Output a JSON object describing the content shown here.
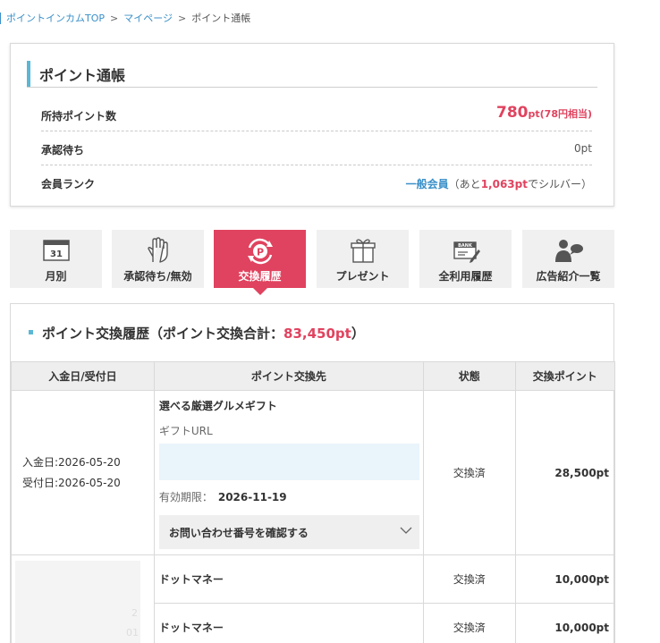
{
  "breadcrumb": {
    "items": [
      "ポイントインカムTOP",
      "マイページ"
    ],
    "separator": ">",
    "current": "ポイント通帳"
  },
  "summary": {
    "title": "ポイント通帳",
    "rows": {
      "held": {
        "label": "所持ポイント数",
        "value": "780",
        "unit": "pt(78円相当)"
      },
      "pending": {
        "label": "承認待ち",
        "value": "0pt"
      },
      "rank": {
        "label": "会員ランク",
        "name": "一般会員",
        "prefix": "（あと",
        "points": "1,063pt",
        "suffix": "でシルバー）"
      }
    }
  },
  "tabs": [
    {
      "label": "月別",
      "icon": "calendar-icon",
      "active": false
    },
    {
      "label": "承認待ち/無効",
      "icon": "hand-icon",
      "active": false
    },
    {
      "label": "交換履歴",
      "icon": "point-exchange-icon",
      "active": true
    },
    {
      "label": "プレゼント",
      "icon": "gift-icon",
      "active": false
    },
    {
      "label": "全利用履歴",
      "icon": "bank-card-icon",
      "active": false
    },
    {
      "label": "広告紹介一覧",
      "icon": "person-chat-icon",
      "active": false
    }
  ],
  "calendar_icon_text": "31",
  "history": {
    "title_prefix": "ポイント交換履歴（ポイント交換合計：",
    "total": "83,450pt",
    "title_suffix": "）",
    "columns": [
      "入金日/受付日",
      "ポイント交換先",
      "状態",
      "交換ポイント"
    ],
    "rows": [
      {
        "deposit_date": "入金日:2026-05-20",
        "accept_date": "受付日:2026-05-20",
        "item": "選べる厳選グルメギフト",
        "gift_url_label": "ギフトURL",
        "expiry_label": "有効期限：",
        "expiry_date": "2026-11-19",
        "inquiry_label": "お問い合わせ番号を確認する",
        "status": "交換済",
        "points": "28,500pt"
      },
      {
        "item": "ドットマネー",
        "status": "交換済",
        "points": "10,000pt"
      },
      {
        "item": "ドットマネー",
        "status": "交換済",
        "points": "10,000pt"
      }
    ],
    "blurred_digits": [
      "2",
      "01"
    ]
  },
  "colors": {
    "accent_red": "#e0435f",
    "accent_blue": "#3a90c9",
    "title_bar": "#5bb8d4"
  }
}
